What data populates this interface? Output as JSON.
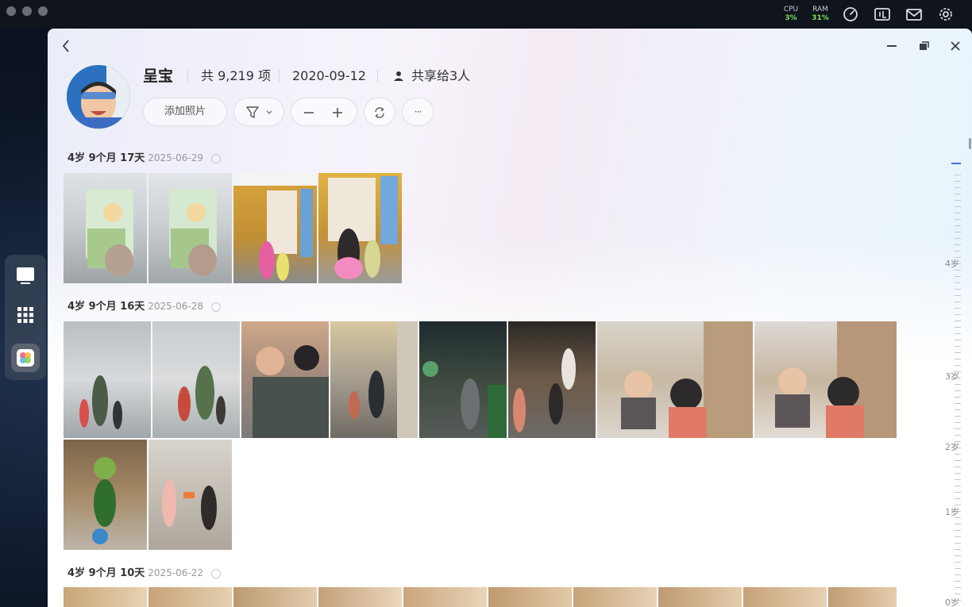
{
  "system": {
    "cpu_label": "CPU",
    "cpu_value": "3%",
    "ram_label": "RAM",
    "ram_value": "31%",
    "icons": [
      "gauge-icon",
      "monitor-icon",
      "mail-icon",
      "gear-icon"
    ]
  },
  "dock": {
    "items": [
      "desktop-icon",
      "apps-grid-icon",
      "photos-app-icon"
    ]
  },
  "album": {
    "name": "呈宝",
    "count": "共 9,219 项",
    "date": "2020-09-12",
    "shared": "共享给3人"
  },
  "toolbar": {
    "add_label": "添加照片",
    "more_label": "···"
  },
  "groups": [
    {
      "title": "4岁 9个月 17天",
      "date": "2025-06-29"
    },
    {
      "title": "4岁 9个月 16天",
      "date": "2025-06-28"
    },
    {
      "title": "4岁 9个月 10天",
      "date": "2025-06-22"
    }
  ],
  "timeline": {
    "labels": [
      "4岁",
      "3岁",
      "2岁",
      "1岁",
      "0岁"
    ]
  },
  "colors": {
    "accent": "#3a6fd8",
    "cpu": "#7be35a"
  }
}
